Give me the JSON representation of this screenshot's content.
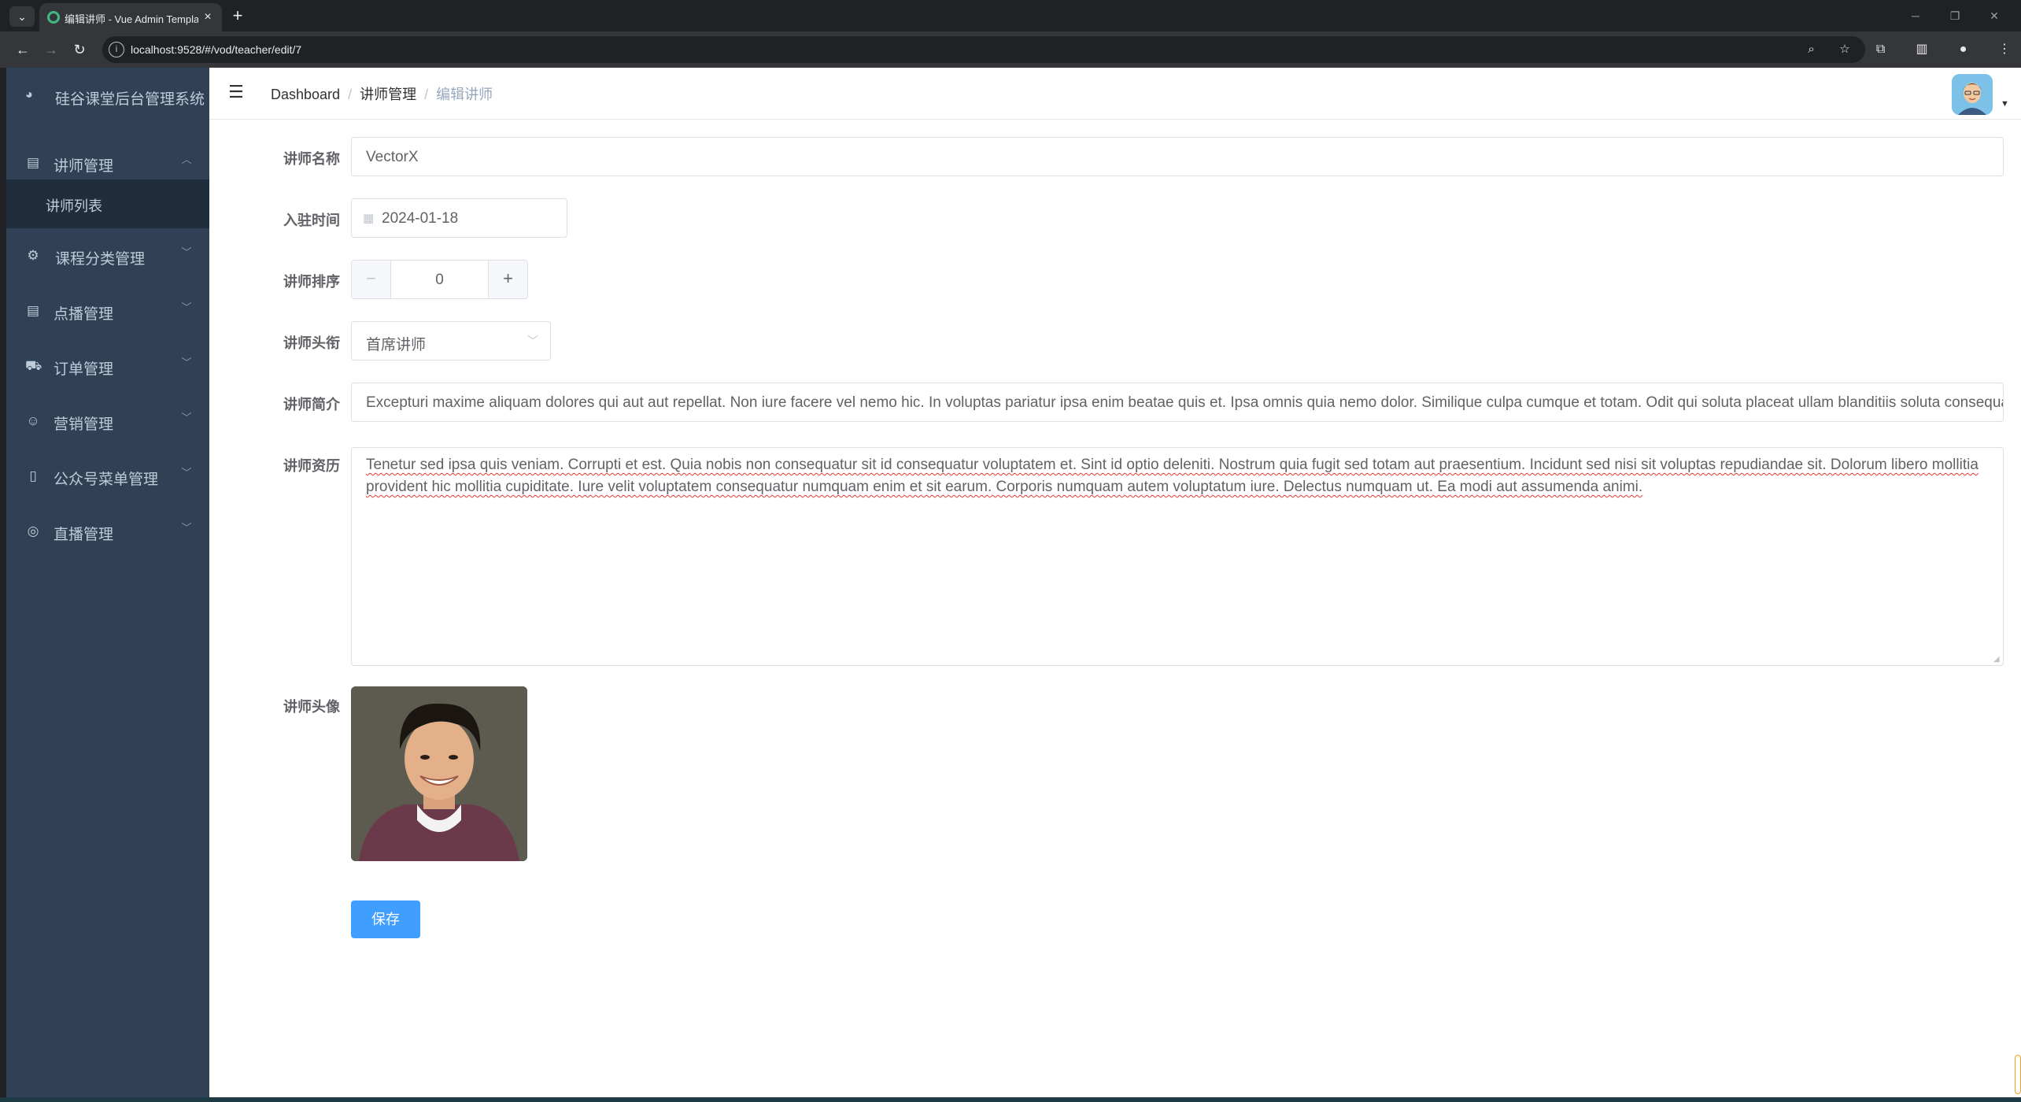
{
  "browser": {
    "tab_title": "编辑讲师 - Vue Admin Template",
    "url": "localhost:9528/#/vod/teacher/edit/7",
    "icons": {
      "tab_search": "chevron-down-icon",
      "tab_close": "close-icon",
      "new_tab": "plus-icon",
      "back": "arrow-left-icon",
      "forward": "arrow-right-icon",
      "reload": "reload-icon",
      "site_info": "info-icon",
      "zoom": "zoom-icon",
      "bookmark": "star-icon",
      "extensions": "puzzle-icon",
      "side_panel": "side-panel-icon",
      "profile": "profile-icon",
      "menu": "kebab-icon"
    }
  },
  "sidebar": {
    "brand_title": "硅谷课堂后台管理系统",
    "brand_icon": "dashboard-icon",
    "menus": [
      {
        "label": "讲师管理",
        "icon": "table-icon",
        "expanded": true
      },
      {
        "label": "课程分类管理",
        "icon": "gear-icon",
        "expanded": false
      },
      {
        "label": "点播管理",
        "icon": "table-icon",
        "expanded": false
      },
      {
        "label": "订单管理",
        "icon": "truck-icon",
        "expanded": false
      },
      {
        "label": "营销管理",
        "icon": "smile-icon",
        "expanded": false
      },
      {
        "label": "公众号菜单管理",
        "icon": "phone-icon",
        "expanded": false
      },
      {
        "label": "直播管理",
        "icon": "help-icon",
        "expanded": false
      }
    ],
    "submenu": [
      {
        "label": "讲师列表",
        "active": true
      }
    ]
  },
  "navbar": {
    "breadcrumb": [
      "Dashboard",
      "讲师管理",
      "编辑讲师"
    ],
    "separator": "/"
  },
  "form": {
    "name": {
      "label": "讲师名称",
      "value": "VectorX"
    },
    "join_date": {
      "label": "入驻时间",
      "value": "2024-01-18"
    },
    "sort": {
      "label": "讲师排序",
      "value": "0",
      "minus": "−",
      "plus": "+"
    },
    "title": {
      "label": "讲师头衔",
      "value": "首席讲师"
    },
    "intro": {
      "label": "讲师简介",
      "value": "Excepturi maxime aliquam dolores qui aut aut repellat. Non iure facere vel nemo hic. In voluptas pariatur ipsa enim beatae quis et. Ipsa omnis quia nemo dolor. Similique culpa cumque et totam. Odit qui soluta placeat ullam blanditiis soluta consequatur."
    },
    "career": {
      "label": "讲师资历",
      "value": "Tenetur sed ipsa quis veniam. Corrupti et est. Quia nobis non consequatur sit id consequatur voluptatem et. Sint id optio deleniti. Nostrum quia fugit sed totam aut praesentium. Incidunt sed nisi sit voluptas repudiandae sit. Dolorum libero mollitia provident hic mollitia cupiditate. Iure velit voluptatem consequatur numquam enim et sit earum. Corporis numquam autem voluptatum iure. Delectus numquam ut. Ea modi aut assumenda animi."
    },
    "avatar": {
      "label": "讲师头像"
    },
    "save_label": "保存"
  }
}
